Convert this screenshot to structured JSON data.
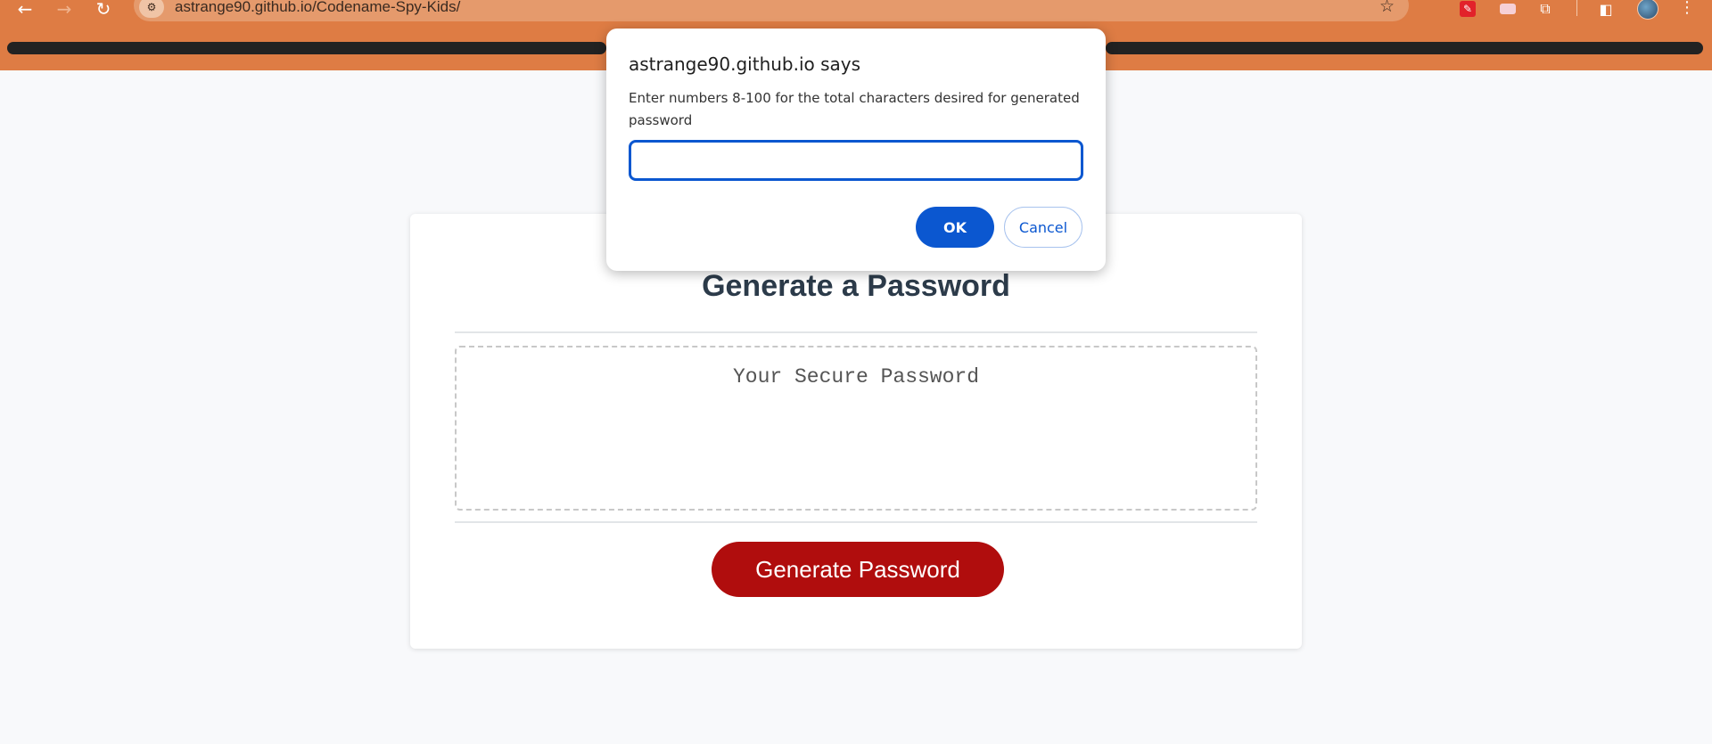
{
  "browser": {
    "url": "astrange90.github.io/Codename-Spy-Kids/",
    "back_icon": "←",
    "forward_icon": "→",
    "reload_icon": "↻",
    "site_info_icon": "⚙",
    "star_icon": "☆",
    "extensions_icon": "⧉",
    "sidepanel_icon": "◧",
    "menu_icon": "⋮",
    "theme_color": "#de7c44"
  },
  "page": {
    "title": "Generate a Password",
    "password_placeholder": "Your Secure Password",
    "generate_button_label": "Generate Password",
    "button_color": "#b00d0d"
  },
  "dialog": {
    "title": "astrange90.github.io says",
    "message": "Enter numbers 8-100 for the total characters desired for generated password",
    "input_value": "",
    "ok_label": "OK",
    "cancel_label": "Cancel",
    "accent_color": "#0b57d0"
  }
}
